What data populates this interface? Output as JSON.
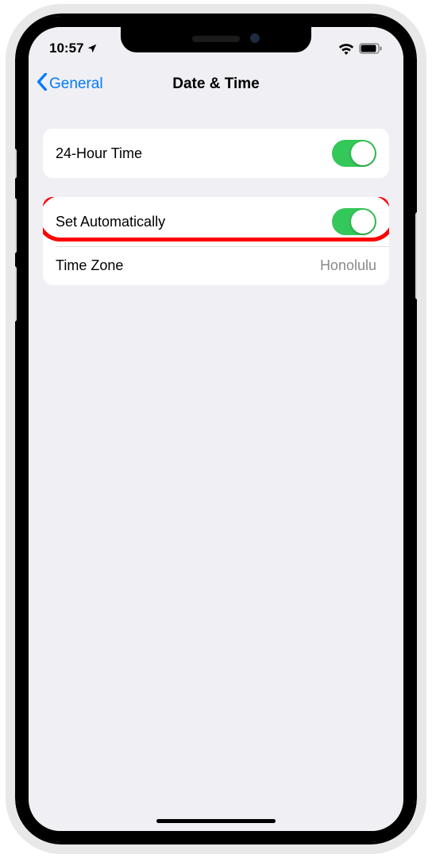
{
  "status": {
    "time": "10:57",
    "location_icon": "location-arrow",
    "wifi": true,
    "battery_level": 85
  },
  "nav": {
    "back_label": "General",
    "title": "Date & Time"
  },
  "group1": {
    "rows": [
      {
        "label": "24-Hour Time",
        "toggle": true
      }
    ]
  },
  "group2": {
    "rows": [
      {
        "label": "Set Automatically",
        "toggle": true
      },
      {
        "label": "Time Zone",
        "value": "Honolulu"
      }
    ]
  },
  "highlight_row": "set-automatically-row",
  "colors": {
    "accent": "#007aff",
    "toggle_on": "#34c759",
    "highlight": "#ff0000"
  }
}
